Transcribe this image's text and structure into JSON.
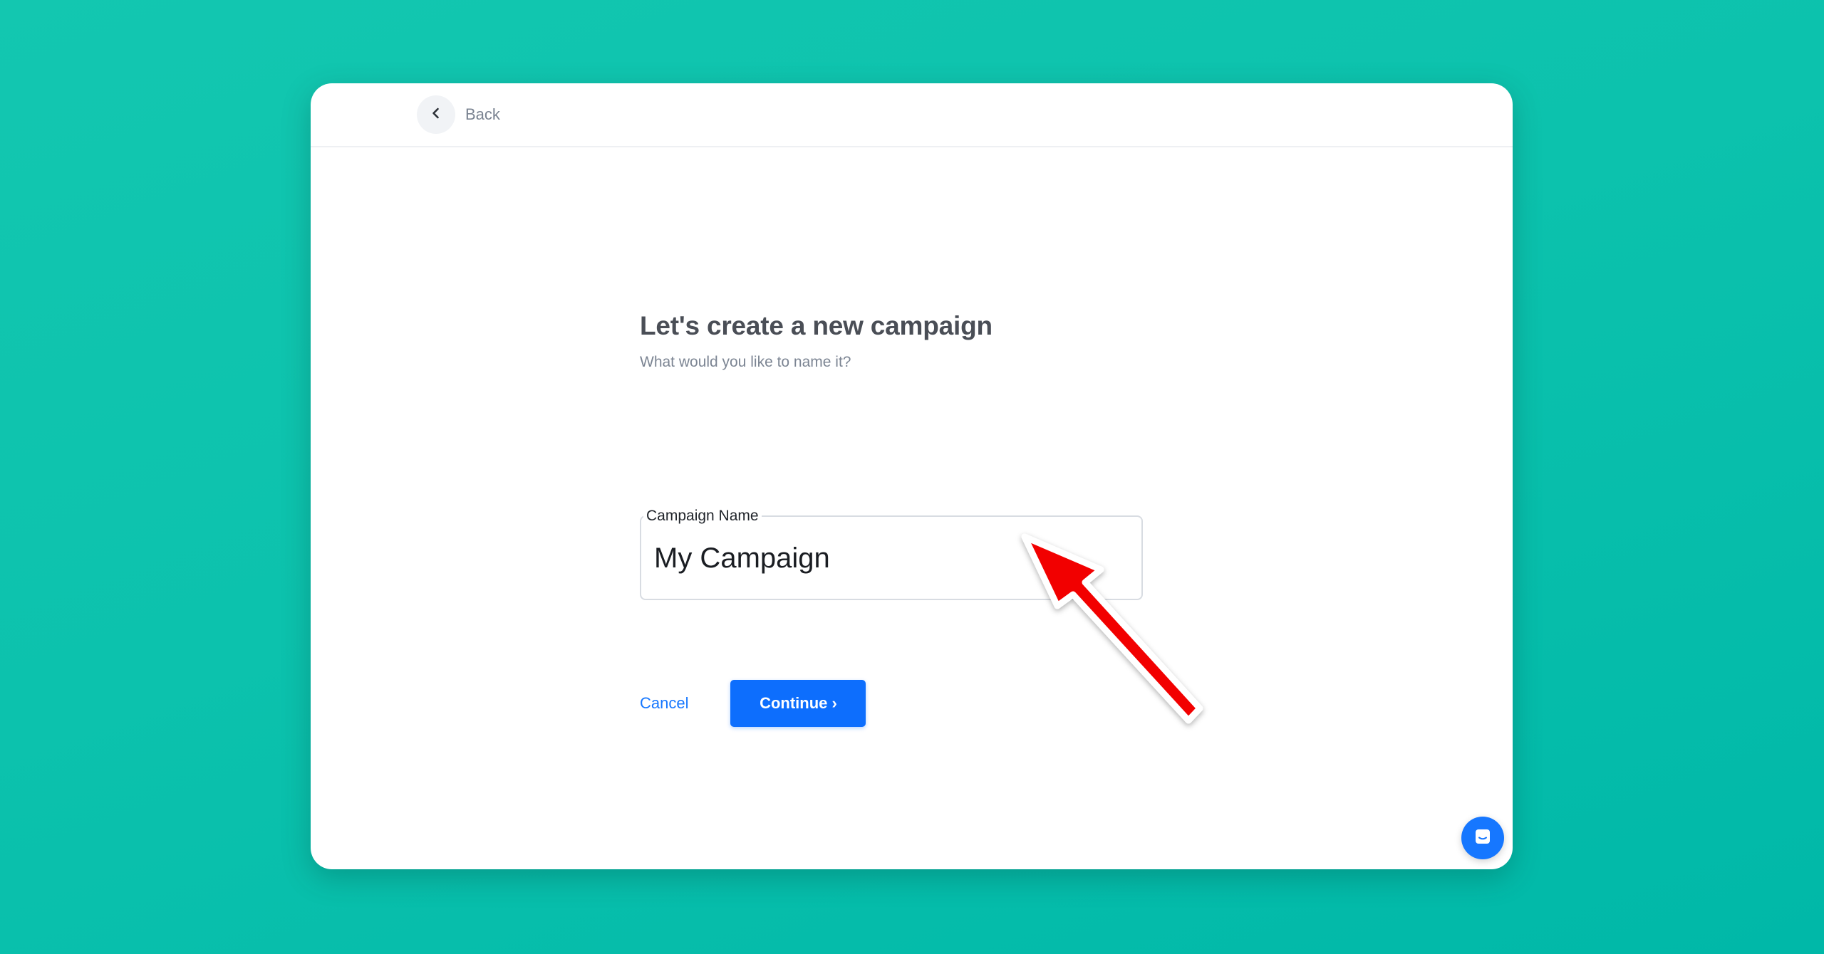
{
  "header": {
    "back_label": "Back"
  },
  "main": {
    "title": "Let's create a new campaign",
    "subtitle": "What would you like to name it?",
    "campaign_field": {
      "label": "Campaign Name",
      "value": "My Campaign"
    }
  },
  "actions": {
    "cancel_label": "Cancel",
    "continue_label": "Continue ›"
  },
  "icons": {
    "back": "chevron-left-icon",
    "chat": "chat-icon",
    "annotation": "red-arrow-annotation"
  },
  "colors": {
    "background": "#0cc2ad",
    "primary": "#0d6efd",
    "link": "#1677ff",
    "annotation": "#f20000"
  }
}
